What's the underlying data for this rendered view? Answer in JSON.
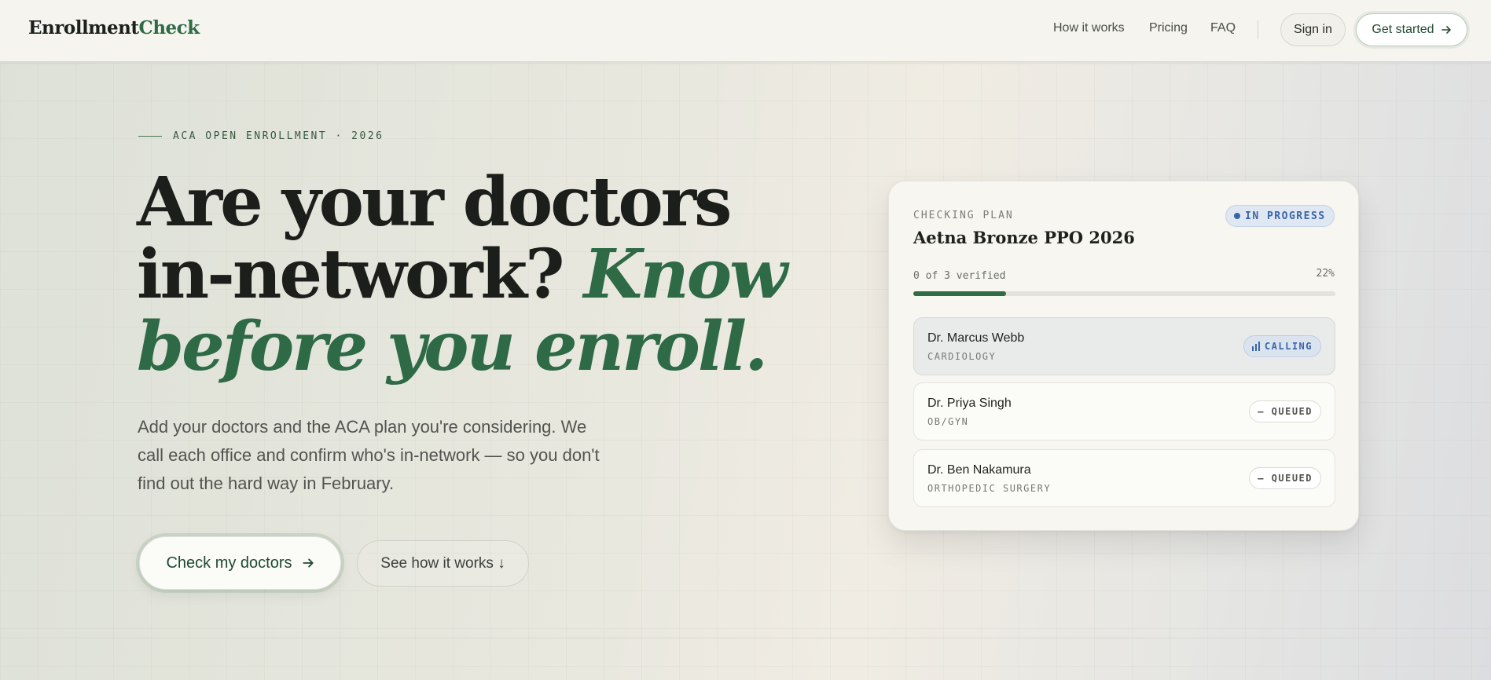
{
  "nav": {
    "logo_primary": "Enrollment",
    "logo_accent": "Check",
    "links": [
      "How it works",
      "Pricing",
      "FAQ"
    ],
    "signin_label": "Sign in",
    "get_started_label": "Get started",
    "arrow_icon": "arrow-right-icon"
  },
  "hero": {
    "eyebrow": "ACA OPEN ENROLLMENT · 2026",
    "headline_plain": "Are your doctors in-network?",
    "headline_accent": "Know before you enroll.",
    "subtext": "Add your doctors and the ACA plan you're considering. We call each office and confirm who's in-network — so you don't find out the hard way in February.",
    "cta_primary": "Check my doctors",
    "cta_secondary": "See how it works ↓"
  },
  "card": {
    "eyebrow": "CHECKING PLAN",
    "plan_name": "Aetna Bronze PPO 2026",
    "status": "IN PROGRESS",
    "progress_label": "0 of 3 verified",
    "progress_pct_label": "22%",
    "progress_fraction": 0.22,
    "colors": {
      "accent": "#2f6b44",
      "status_blue": "#3a64a8"
    },
    "doctors": [
      {
        "name": "Dr. Marcus Webb",
        "specialty": "CARDIOLOGY",
        "status": "CALLING"
      },
      {
        "name": "Dr. Priya Singh",
        "specialty": "OB/GYN",
        "status": "— QUEUED"
      },
      {
        "name": "Dr. Ben Nakamura",
        "specialty": "ORTHOPEDIC SURGERY",
        "status": "— QUEUED"
      }
    ]
  }
}
